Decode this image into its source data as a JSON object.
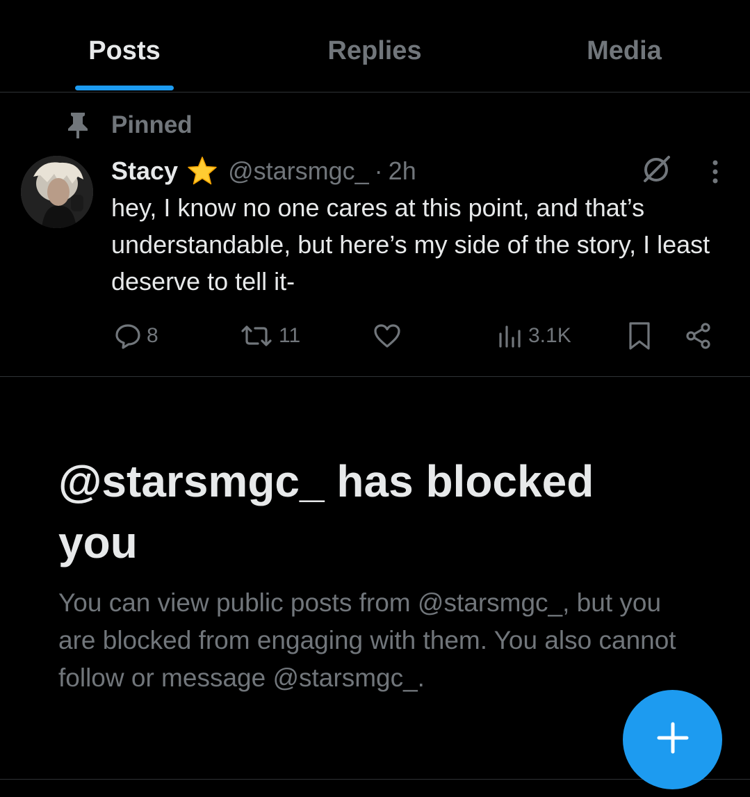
{
  "tabs": [
    {
      "label": "Posts",
      "active": true
    },
    {
      "label": "Replies",
      "active": false
    },
    {
      "label": "Media",
      "active": false
    }
  ],
  "colors": {
    "accent": "#1d9bf0",
    "muted": "#71767b",
    "text": "#e7e9ea",
    "background": "#000000",
    "divider": "#2f3336"
  },
  "pinned": {
    "label": "Pinned",
    "icon": "pin-icon"
  },
  "post": {
    "author_name": "Stacy",
    "badge_icon": "star-icon",
    "handle": "@starsmgc_",
    "separator": "·",
    "time": "2h",
    "text": "hey, I know no one cares at this point, and that’s understandable, but here’s my side of the story, I least deserve to tell it-",
    "actions": {
      "replies": "8",
      "reposts": "11",
      "likes": "",
      "views": "3.1K"
    }
  },
  "blocked": {
    "title": "@starsmgc_ has blocked you",
    "description": "You can view public posts from @starsmgc_, but you are blocked from engaging with them. You also cannot follow or message @starsmgc_."
  },
  "fab": {
    "icon": "plus-icon"
  }
}
